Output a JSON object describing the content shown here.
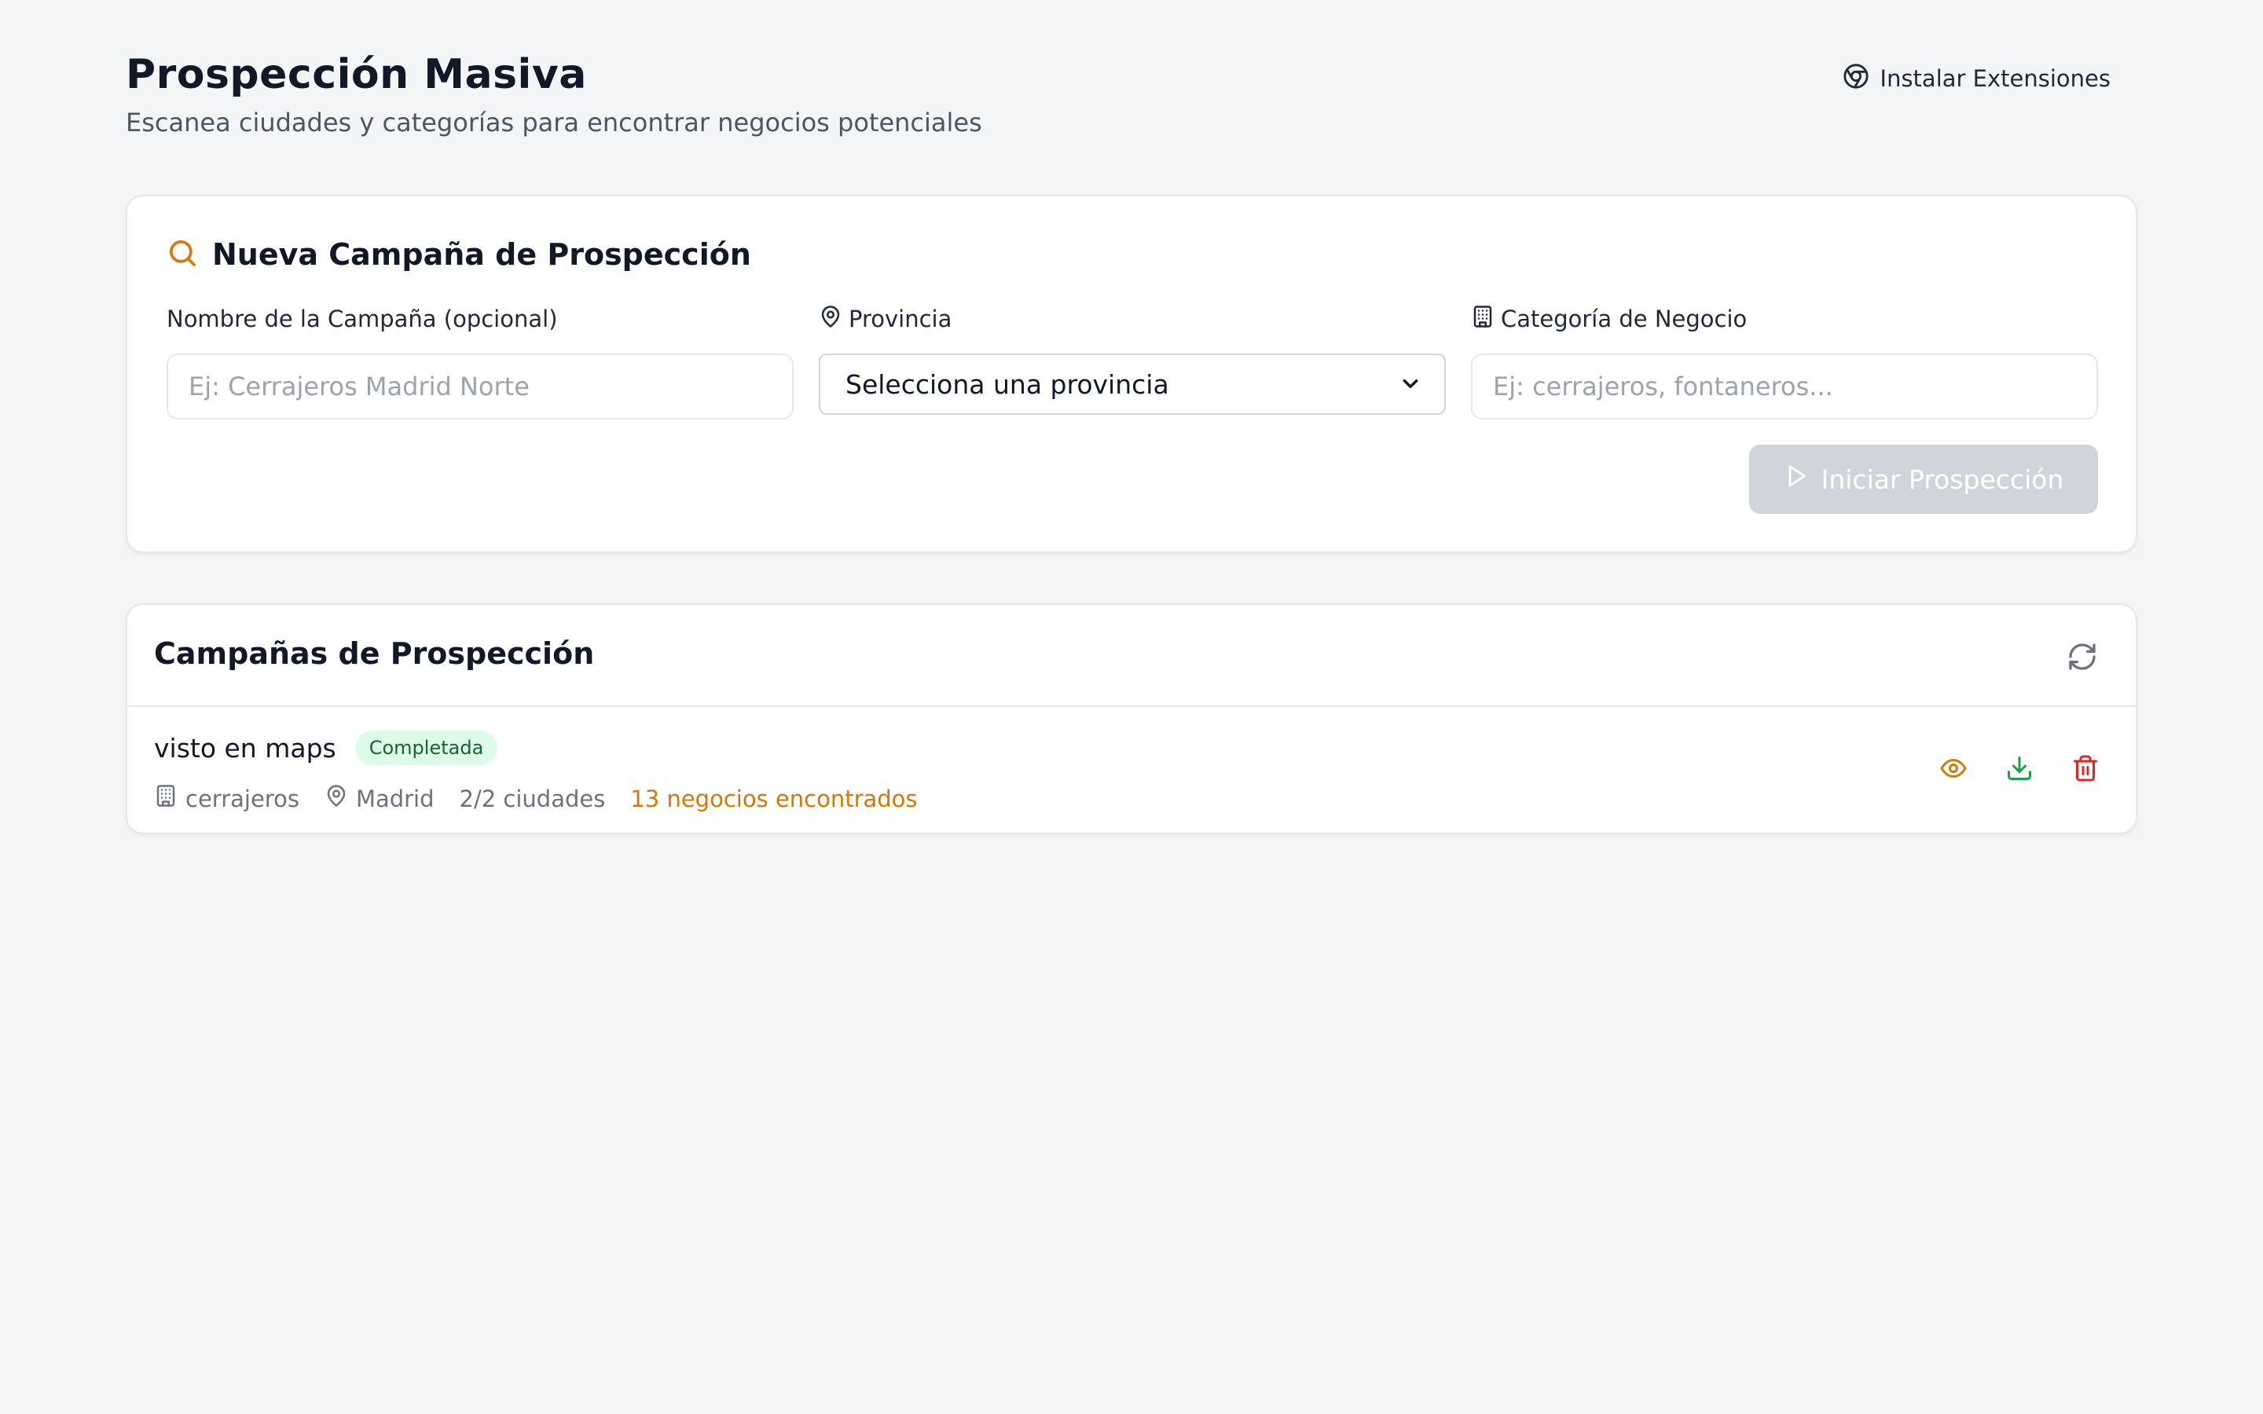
{
  "header": {
    "title": "Prospección Masiva",
    "subtitle": "Escanea ciudades y categorías para encontrar negocios potenciales",
    "install_button": {
      "label": "Instalar Extensiones",
      "icon": "chrome-icon"
    }
  },
  "new_campaign": {
    "title": "Nueva Campaña de Prospección",
    "title_icon": "search-icon",
    "fields": {
      "name": {
        "label": "Nombre de la Campaña (opcional)",
        "placeholder": "Ej: Cerrajeros Madrid Norte",
        "value": ""
      },
      "province": {
        "label": "Provincia",
        "icon": "map-pin-icon",
        "selected": "Selecciona una provincia"
      },
      "category": {
        "label": "Categoría de Negocio",
        "icon": "building-icon",
        "placeholder": "Ej: cerrajeros, fontaneros...",
        "value": ""
      }
    },
    "start_button": {
      "label": "Iniciar Prospección",
      "icon": "play-icon",
      "enabled": false
    }
  },
  "campaigns": {
    "title": "Campañas de Prospección",
    "refresh_icon": "refresh-icon",
    "items": [
      {
        "name": "visto en maps",
        "status": "Completada",
        "category": "cerrajeros",
        "province": "Madrid",
        "cities": "2/2 ciudades",
        "found": "13 negocios encontrados",
        "actions": [
          "view-icon",
          "download-icon",
          "trash-icon"
        ]
      }
    ]
  },
  "colors": {
    "accent": "#d97706",
    "status_bg": "#dcfce7",
    "status_text": "#166534",
    "download": "#16a34a",
    "delete": "#dc2626",
    "disabled_button": "#d1d5db",
    "page_bg": "#f4f5f7"
  }
}
